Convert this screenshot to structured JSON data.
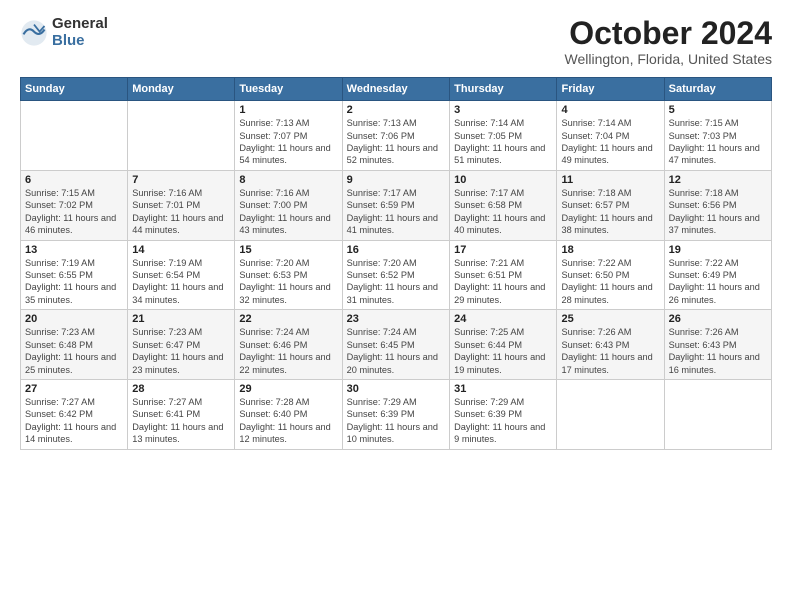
{
  "logo": {
    "general": "General",
    "blue": "Blue"
  },
  "title": "October 2024",
  "location": "Wellington, Florida, United States",
  "days_of_week": [
    "Sunday",
    "Monday",
    "Tuesday",
    "Wednesday",
    "Thursday",
    "Friday",
    "Saturday"
  ],
  "weeks": [
    [
      {
        "day": "",
        "info": ""
      },
      {
        "day": "",
        "info": ""
      },
      {
        "day": "1",
        "info": "Sunrise: 7:13 AM\nSunset: 7:07 PM\nDaylight: 11 hours and 54 minutes."
      },
      {
        "day": "2",
        "info": "Sunrise: 7:13 AM\nSunset: 7:06 PM\nDaylight: 11 hours and 52 minutes."
      },
      {
        "day": "3",
        "info": "Sunrise: 7:14 AM\nSunset: 7:05 PM\nDaylight: 11 hours and 51 minutes."
      },
      {
        "day": "4",
        "info": "Sunrise: 7:14 AM\nSunset: 7:04 PM\nDaylight: 11 hours and 49 minutes."
      },
      {
        "day": "5",
        "info": "Sunrise: 7:15 AM\nSunset: 7:03 PM\nDaylight: 11 hours and 47 minutes."
      }
    ],
    [
      {
        "day": "6",
        "info": "Sunrise: 7:15 AM\nSunset: 7:02 PM\nDaylight: 11 hours and 46 minutes."
      },
      {
        "day": "7",
        "info": "Sunrise: 7:16 AM\nSunset: 7:01 PM\nDaylight: 11 hours and 44 minutes."
      },
      {
        "day": "8",
        "info": "Sunrise: 7:16 AM\nSunset: 7:00 PM\nDaylight: 11 hours and 43 minutes."
      },
      {
        "day": "9",
        "info": "Sunrise: 7:17 AM\nSunset: 6:59 PM\nDaylight: 11 hours and 41 minutes."
      },
      {
        "day": "10",
        "info": "Sunrise: 7:17 AM\nSunset: 6:58 PM\nDaylight: 11 hours and 40 minutes."
      },
      {
        "day": "11",
        "info": "Sunrise: 7:18 AM\nSunset: 6:57 PM\nDaylight: 11 hours and 38 minutes."
      },
      {
        "day": "12",
        "info": "Sunrise: 7:18 AM\nSunset: 6:56 PM\nDaylight: 11 hours and 37 minutes."
      }
    ],
    [
      {
        "day": "13",
        "info": "Sunrise: 7:19 AM\nSunset: 6:55 PM\nDaylight: 11 hours and 35 minutes."
      },
      {
        "day": "14",
        "info": "Sunrise: 7:19 AM\nSunset: 6:54 PM\nDaylight: 11 hours and 34 minutes."
      },
      {
        "day": "15",
        "info": "Sunrise: 7:20 AM\nSunset: 6:53 PM\nDaylight: 11 hours and 32 minutes."
      },
      {
        "day": "16",
        "info": "Sunrise: 7:20 AM\nSunset: 6:52 PM\nDaylight: 11 hours and 31 minutes."
      },
      {
        "day": "17",
        "info": "Sunrise: 7:21 AM\nSunset: 6:51 PM\nDaylight: 11 hours and 29 minutes."
      },
      {
        "day": "18",
        "info": "Sunrise: 7:22 AM\nSunset: 6:50 PM\nDaylight: 11 hours and 28 minutes."
      },
      {
        "day": "19",
        "info": "Sunrise: 7:22 AM\nSunset: 6:49 PM\nDaylight: 11 hours and 26 minutes."
      }
    ],
    [
      {
        "day": "20",
        "info": "Sunrise: 7:23 AM\nSunset: 6:48 PM\nDaylight: 11 hours and 25 minutes."
      },
      {
        "day": "21",
        "info": "Sunrise: 7:23 AM\nSunset: 6:47 PM\nDaylight: 11 hours and 23 minutes."
      },
      {
        "day": "22",
        "info": "Sunrise: 7:24 AM\nSunset: 6:46 PM\nDaylight: 11 hours and 22 minutes."
      },
      {
        "day": "23",
        "info": "Sunrise: 7:24 AM\nSunset: 6:45 PM\nDaylight: 11 hours and 20 minutes."
      },
      {
        "day": "24",
        "info": "Sunrise: 7:25 AM\nSunset: 6:44 PM\nDaylight: 11 hours and 19 minutes."
      },
      {
        "day": "25",
        "info": "Sunrise: 7:26 AM\nSunset: 6:43 PM\nDaylight: 11 hours and 17 minutes."
      },
      {
        "day": "26",
        "info": "Sunrise: 7:26 AM\nSunset: 6:43 PM\nDaylight: 11 hours and 16 minutes."
      }
    ],
    [
      {
        "day": "27",
        "info": "Sunrise: 7:27 AM\nSunset: 6:42 PM\nDaylight: 11 hours and 14 minutes."
      },
      {
        "day": "28",
        "info": "Sunrise: 7:27 AM\nSunset: 6:41 PM\nDaylight: 11 hours and 13 minutes."
      },
      {
        "day": "29",
        "info": "Sunrise: 7:28 AM\nSunset: 6:40 PM\nDaylight: 11 hours and 12 minutes."
      },
      {
        "day": "30",
        "info": "Sunrise: 7:29 AM\nSunset: 6:39 PM\nDaylight: 11 hours and 10 minutes."
      },
      {
        "day": "31",
        "info": "Sunrise: 7:29 AM\nSunset: 6:39 PM\nDaylight: 11 hours and 9 minutes."
      },
      {
        "day": "",
        "info": ""
      },
      {
        "day": "",
        "info": ""
      }
    ]
  ]
}
